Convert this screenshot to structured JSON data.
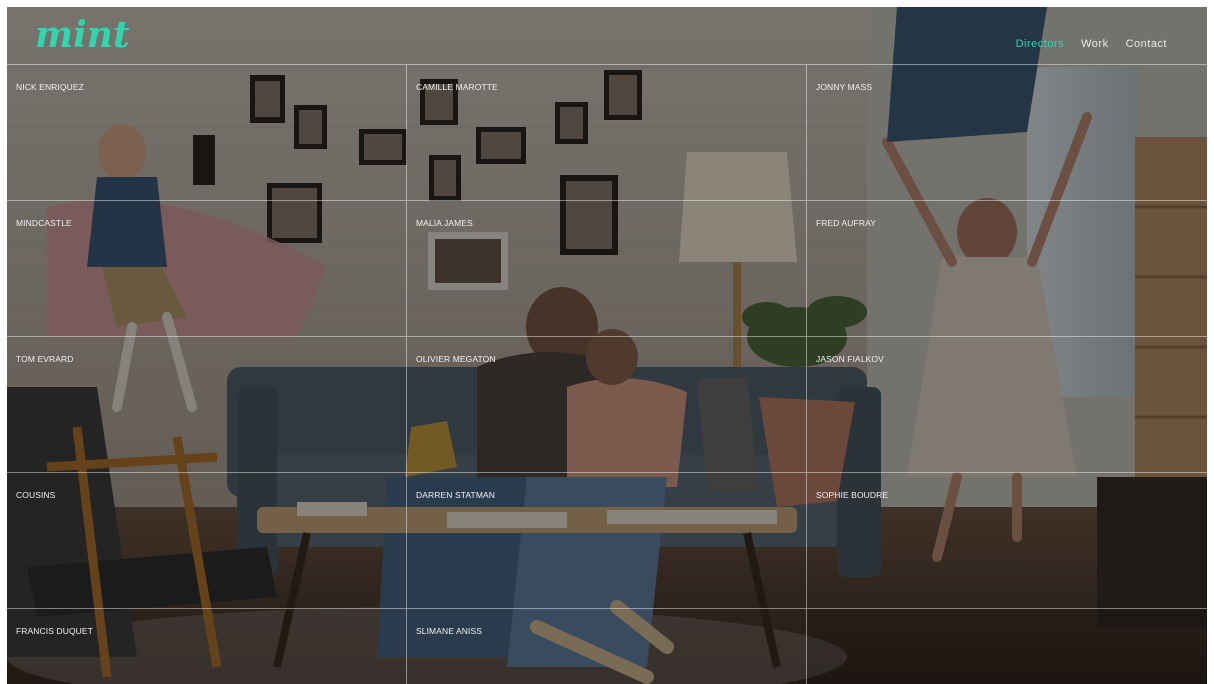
{
  "brand": {
    "logo_text": "mint",
    "accent_color": "#2fd6b0"
  },
  "nav": {
    "items": [
      {
        "label": "Directors",
        "active": true,
        "color": "#2fd6b0"
      },
      {
        "label": "Work",
        "active": false
      },
      {
        "label": "Contact",
        "active": false
      }
    ]
  },
  "directors": [
    "NICK ENRIQUEZ",
    "CAMILLE MAROTTE",
    "JONNY MASS",
    "MINDCASTLE",
    "MALIA JAMES",
    "FRED AUFRAY",
    "TOM EVRARD",
    "OLIVIER MEGATON",
    "JASON FIALKOV",
    "COUSINS",
    "DARREN STATMAN",
    "SOPHIE BOUDRE",
    "FRANCIS DUQUET",
    "SLIMANE ANISS",
    ""
  ]
}
